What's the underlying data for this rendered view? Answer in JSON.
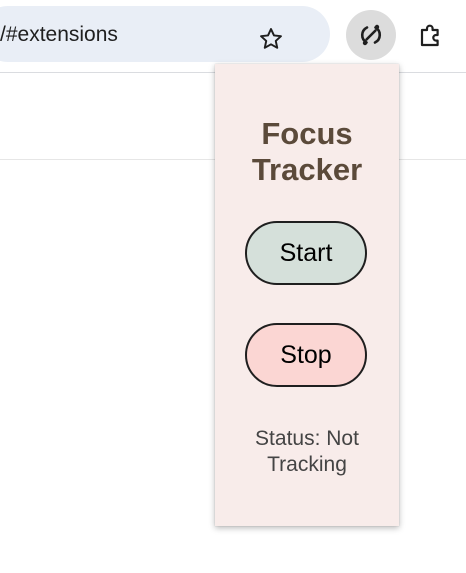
{
  "browser": {
    "url_text": "/#extensions",
    "bookmark_icon": "star-icon",
    "active_extension_icon": "focus-tracker-icon",
    "extensions_menu_icon": "puzzle-icon"
  },
  "popup": {
    "title_line1": "Focus",
    "title_line2": "Tracker",
    "start_label": "Start",
    "stop_label": "Stop",
    "status_line1": "Status: Not",
    "status_line2": "Tracking"
  },
  "colors": {
    "popup_background": "#f8ecea",
    "title": "#5b4a3a",
    "start_button": "#d5e0da",
    "stop_button": "#fbd6d3",
    "omnibox": "#e9eef6"
  }
}
